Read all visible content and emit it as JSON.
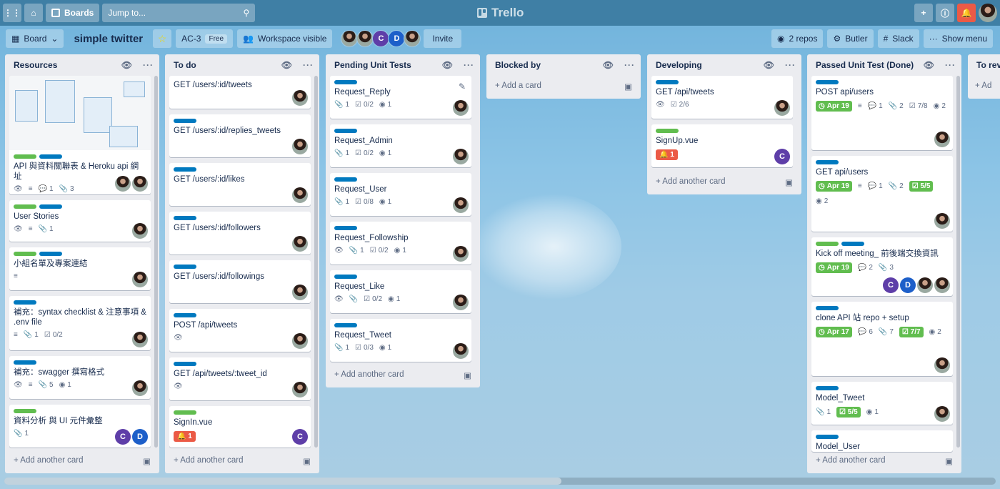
{
  "topbar": {
    "boards_label": "Boards",
    "search_placeholder": "Jump to...",
    "logo": "Trello"
  },
  "header": {
    "board_menu": "Board",
    "title": "simple twitter",
    "workspace": "AC-3",
    "plan": "Free",
    "visibility": "Workspace visible",
    "invite": "Invite",
    "repos": "2 repos",
    "butler": "Butler",
    "slack": "Slack",
    "show_menu": "Show menu",
    "members": [
      "photo",
      "photo",
      "C",
      "D",
      "photo"
    ]
  },
  "colors": {
    "green": "#61bd4f",
    "blue": "#0079bf",
    "red": "#eb5a46"
  },
  "add_card": "Add another card",
  "lists": [
    {
      "name": "Resources",
      "cards": [
        {
          "title": "API 與資料關聯表 & Heroku api 網址",
          "badges": [
            "1",
            "3"
          ]
        },
        {
          "title": "User Stories",
          "badges": [
            "1"
          ]
        },
        {
          "title": "小組名單及專案連結",
          "badges": []
        },
        {
          "title": "補充：syntax checklist & 注意事項 & .env file",
          "badges": [
            "1",
            "0/2"
          ]
        },
        {
          "title": "補充：swagger 撰寫格式",
          "badges": [
            "5",
            "1"
          ]
        },
        {
          "title": "資料分析 與 UI 元件彙整",
          "badges": [
            "1"
          ]
        }
      ]
    },
    {
      "name": "To do",
      "cards": [
        {
          "title": "GET /users/:id/tweets"
        },
        {
          "title": "GET /users/:id/replies_tweets"
        },
        {
          "title": "GET /users/:id/likes"
        },
        {
          "title": "GET /users/:id/followers"
        },
        {
          "title": "GET /users/:id/followings"
        },
        {
          "title": "POST /api/tweets"
        },
        {
          "title": "GET /api/tweets/:tweet_id"
        },
        {
          "title": "SignIn.vue",
          "bell": "1"
        }
      ]
    },
    {
      "name": "Pending Unit Tests",
      "cards": [
        {
          "title": "Request_Reply",
          "badges": [
            "1",
            "0/2",
            "1"
          ]
        },
        {
          "title": "Request_Admin",
          "badges": [
            "1",
            "0/2",
            "1"
          ]
        },
        {
          "title": "Request_User",
          "badges": [
            "1",
            "0/8",
            "1"
          ]
        },
        {
          "title": "Request_Followship",
          "badges": [
            "1",
            "0/2",
            "1"
          ]
        },
        {
          "title": "Request_Like",
          "badges": [
            "0/2",
            "1"
          ]
        },
        {
          "title": "Request_Tweet",
          "badges": [
            "1",
            "0/3",
            "1"
          ]
        }
      ]
    },
    {
      "name": "Blocked by",
      "add": "Add a card"
    },
    {
      "name": "Developing",
      "cards": [
        {
          "title": "GET /api/tweets",
          "badges": [
            "2/6"
          ]
        },
        {
          "title": "SignUp.vue",
          "bell": "1"
        }
      ]
    },
    {
      "name": "Passed Unit Test (Done)",
      "cards": [
        {
          "title": "POST api/users",
          "date": "Apr 19",
          "badges": [
            "1",
            "2",
            "7/8",
            "2"
          ]
        },
        {
          "title": "GET api/users",
          "date": "Apr 19",
          "badges": [
            "1",
            "2",
            "5/5",
            "2"
          ]
        },
        {
          "title": "Kick off meeting_ 前後端交換資訊",
          "date": "Apr 19",
          "badges": [
            "2",
            "3"
          ]
        },
        {
          "title": "clone API 站 repo + setup",
          "date": "Apr 17",
          "badges": [
            "6",
            "7",
            "7/7",
            "2"
          ]
        },
        {
          "title": "Model_Tweet",
          "badges": [
            "1",
            "5/5",
            "1"
          ]
        },
        {
          "title": "Model_User"
        }
      ]
    },
    {
      "name": "To revi",
      "add": "Ad"
    }
  ]
}
